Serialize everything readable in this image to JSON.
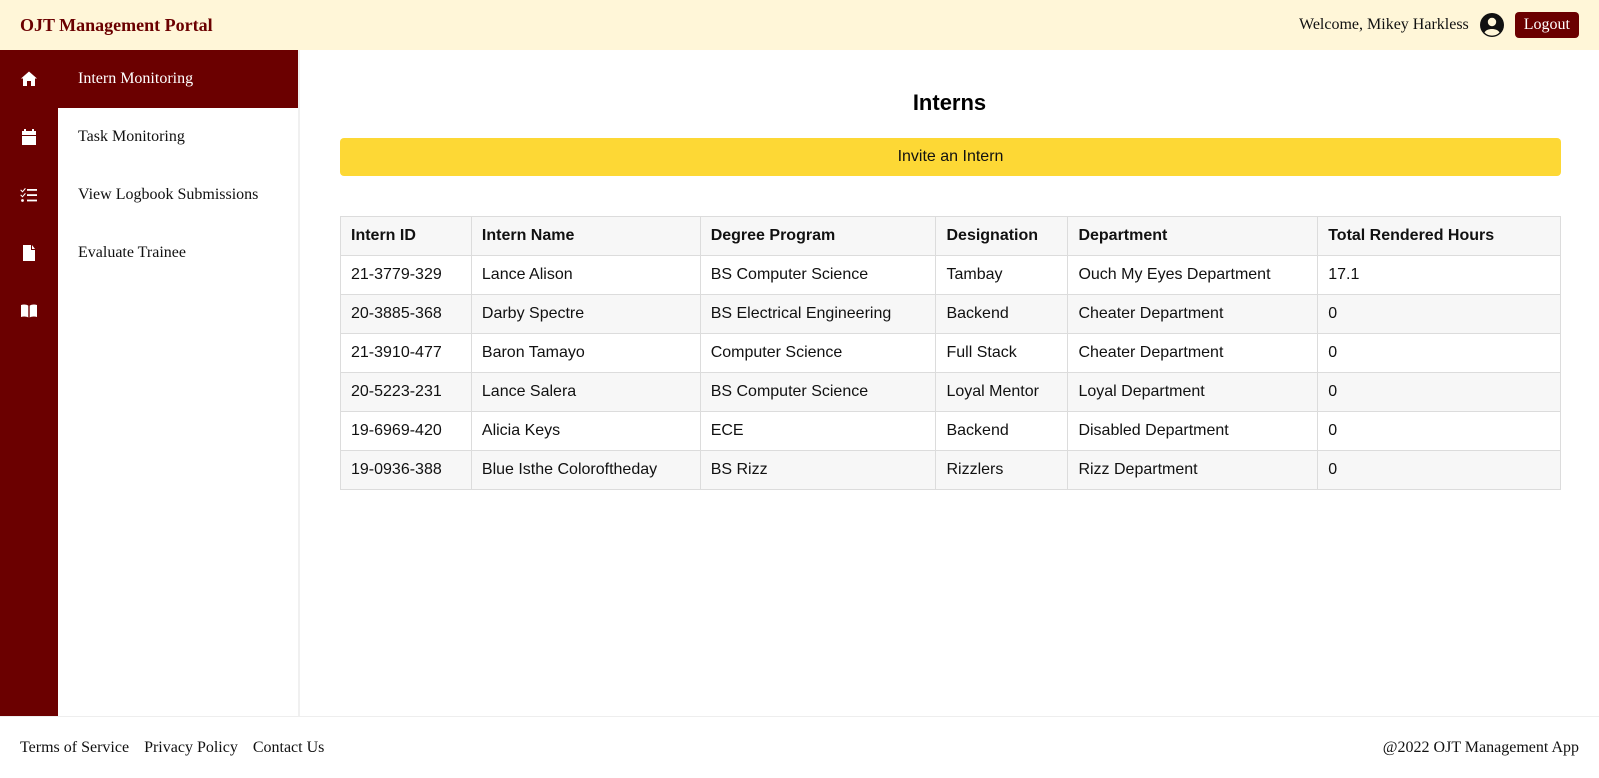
{
  "header": {
    "brand": "OJT Management Portal",
    "welcome": "Welcome, Mikey Harkless",
    "logout_label": "Logout"
  },
  "rail": {
    "icons": [
      "home-icon",
      "calendar-icon",
      "checklist-icon",
      "document-icon",
      "book-icon"
    ]
  },
  "sidebar": {
    "items": [
      {
        "label": "Intern Monitoring",
        "active": true
      },
      {
        "label": "Task Monitoring"
      },
      {
        "label": "View Logbook Submissions"
      },
      {
        "label": "Evaluate Trainee"
      }
    ]
  },
  "main": {
    "title": "Interns",
    "invite_label": "Invite an Intern",
    "table": {
      "headers": [
        "Intern ID",
        "Intern Name",
        "Degree Program",
        "Designation",
        "Department",
        "Total Rendered Hours"
      ],
      "rows": [
        [
          "21-3779-329",
          "Lance Alison",
          "BS Computer Science",
          "Tambay",
          "Ouch My Eyes Department",
          "17.1"
        ],
        [
          "20-3885-368",
          "Darby Spectre",
          "BS Electrical Engineering",
          "Backend",
          "Cheater Department",
          "0"
        ],
        [
          "21-3910-477",
          "Baron Tamayo",
          "Computer Science",
          "Full Stack",
          "Cheater Department",
          "0"
        ],
        [
          "20-5223-231",
          "Lance Salera",
          "BS Computer Science",
          "Loyal Mentor",
          "Loyal Department",
          "0"
        ],
        [
          "19-6969-420",
          "Alicia Keys",
          "ECE",
          "Backend",
          "Disabled Department",
          "0"
        ],
        [
          "19-0936-388",
          "Blue Isthe Coloroftheday",
          "BS Rizz",
          "Rizzlers",
          "Rizz Department",
          "0"
        ]
      ]
    }
  },
  "footer": {
    "links": [
      "Terms of Service",
      "Privacy Policy",
      "Contact Us"
    ],
    "copyright": "@2022 OJT Management App"
  },
  "colors": {
    "brand_maroon": "#6b0000",
    "header_bg": "#fff6d8",
    "accent_yellow": "#fdd835"
  }
}
